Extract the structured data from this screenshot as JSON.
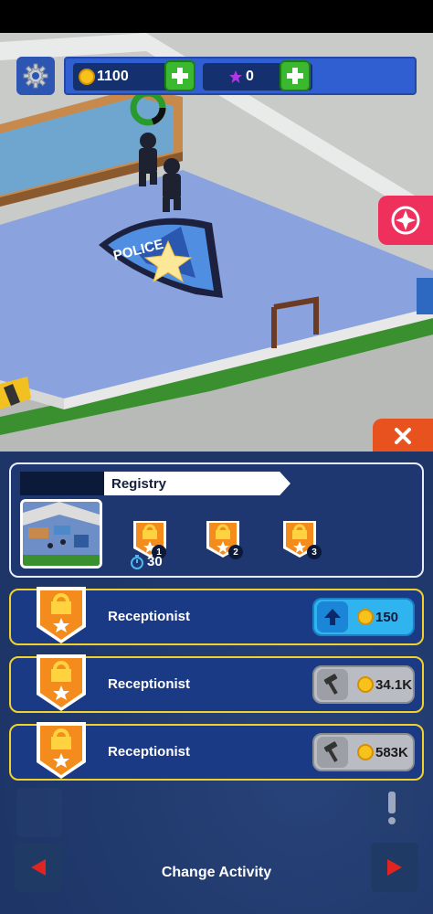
{
  "hud": {
    "coins": "1100",
    "stars": "0"
  },
  "registry": {
    "title": "Registry",
    "levels": [
      "1",
      "2",
      "3"
    ],
    "timer": "30"
  },
  "workers": [
    {
      "name": "Receptionist",
      "cost": "150",
      "action": "upgrade-arrow-icon"
    },
    {
      "name": "Receptionist",
      "cost": "34.1K",
      "action": "hammer-icon"
    },
    {
      "name": "Receptionist",
      "cost": "583K",
      "action": "hammer-icon"
    }
  ],
  "footer": {
    "change_activity": "Change Activity"
  },
  "scene": {
    "badge_text": "POLICE"
  },
  "colors": {
    "accent_red": "#ef2f5c",
    "close_orange": "#e8521e",
    "panel_blue": "#1d3567",
    "highlight_yellow": "#f2d22a"
  }
}
